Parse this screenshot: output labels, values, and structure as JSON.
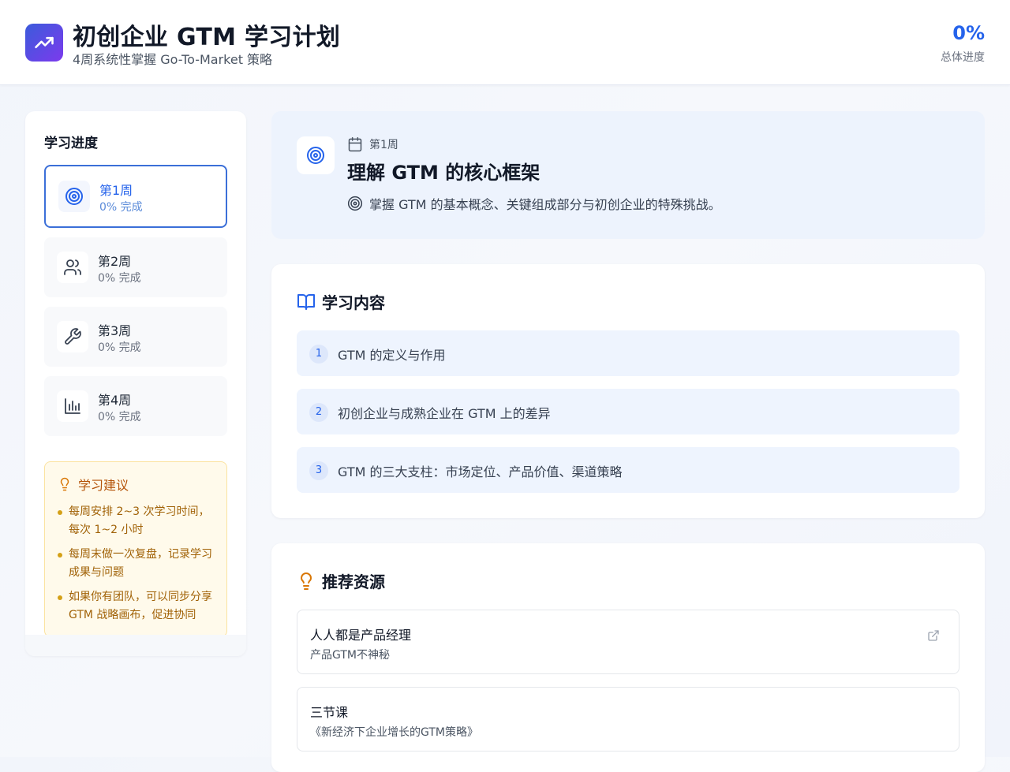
{
  "app": {
    "title": "初创企业 GTM 学习计划",
    "subtitle": "4周系统性掌握 Go-To-Market 策略",
    "overall_progress_value": "0%",
    "overall_progress_label": "总体进度",
    "accent_color": "#2563eb"
  },
  "sidebar": {
    "title": "学习进度",
    "weeks": [
      {
        "label": "第1周",
        "progress": "0% 完成",
        "icon": "target-icon",
        "active": true
      },
      {
        "label": "第2周",
        "progress": "0% 完成",
        "icon": "users-icon",
        "active": false
      },
      {
        "label": "第3周",
        "progress": "0% 完成",
        "icon": "wrench-icon",
        "active": false
      },
      {
        "label": "第4周",
        "progress": "0% 完成",
        "icon": "bar-chart-icon",
        "active": false
      }
    ],
    "tips": {
      "title": "学习建议",
      "items": [
        "每周安排 2~3 次学习时间，每次 1~2 小时",
        "每周末做一次复盘，记录学习成果与问题",
        "如果你有团队，可以同步分享 GTM 战略画布，促进协同"
      ]
    }
  },
  "week": {
    "label": "第1周",
    "title": "理解 GTM 的核心框架",
    "goal": "掌握 GTM 的基本概念、关键组成部分与初创企业的特殊挑战。"
  },
  "content": {
    "title": "学习内容",
    "topics": [
      {
        "num": "1",
        "text": "GTM 的定义与作用"
      },
      {
        "num": "2",
        "text": "初创企业与成熟企业在 GTM 上的差异"
      },
      {
        "num": "3",
        "text": "GTM 的三大支柱：市场定位、产品价值、渠道策略"
      }
    ]
  },
  "resources": {
    "title": "推荐资源",
    "items": [
      {
        "name": "人人都是产品经理",
        "desc": "产品GTM不神秘"
      },
      {
        "name": "三节课",
        "desc": "《新经济下企业增长的GTM策略》"
      }
    ]
  }
}
